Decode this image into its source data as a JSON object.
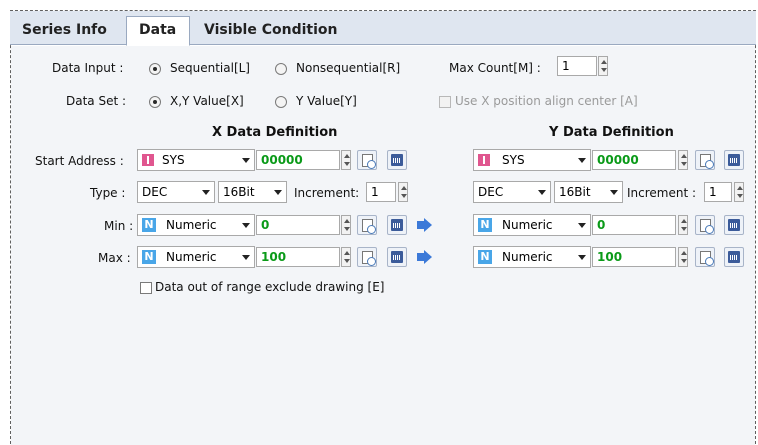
{
  "tabs": [
    {
      "label": "Series Info",
      "active": false
    },
    {
      "label": "Data",
      "active": true
    },
    {
      "label": "Visible Condition",
      "active": false
    }
  ],
  "data_input": {
    "label": "Data Input :",
    "options": [
      "Sequential[L]",
      "Nonsequential[R]"
    ],
    "selected": "Sequential[L]"
  },
  "max_count": {
    "label": "Max Count[M] :",
    "value": "1"
  },
  "data_set": {
    "label": "Data Set :",
    "options": [
      "X,Y Value[X]",
      "Y Value[Y]"
    ],
    "selected": "X,Y Value[X]"
  },
  "use_x_center": {
    "label": "Use X position align center [A]",
    "checked": false,
    "enabled": false
  },
  "x_def": {
    "title": "X Data Definition",
    "start_label": "Start Address :",
    "start_device": "SYS",
    "start_value": "00000",
    "type_label": "Type :",
    "type_value": "DEC",
    "bits_value": "16Bit",
    "increment_label": "Increment:",
    "increment_value": "1",
    "min_label": "Min :",
    "min_mode": "Numeric",
    "min_value": "0",
    "max_label": "Max :",
    "max_mode": "Numeric",
    "max_value": "100"
  },
  "y_def": {
    "title": "Y Data Definition",
    "start_device": "SYS",
    "start_value": "00000",
    "type_value": "DEC",
    "bits_value": "16Bit",
    "increment_label": "Increment :",
    "increment_value": "1",
    "min_mode": "Numeric",
    "min_value": "0",
    "max_mode": "Numeric",
    "max_value": "100"
  },
  "exclude_out_of_range": {
    "label": "Data out of range exclude drawing [E]",
    "checked": false
  },
  "colors": {
    "accent_green": "#0a9a18",
    "tab_bar": "#dfe6f0",
    "panel": "#f3f5f8"
  }
}
